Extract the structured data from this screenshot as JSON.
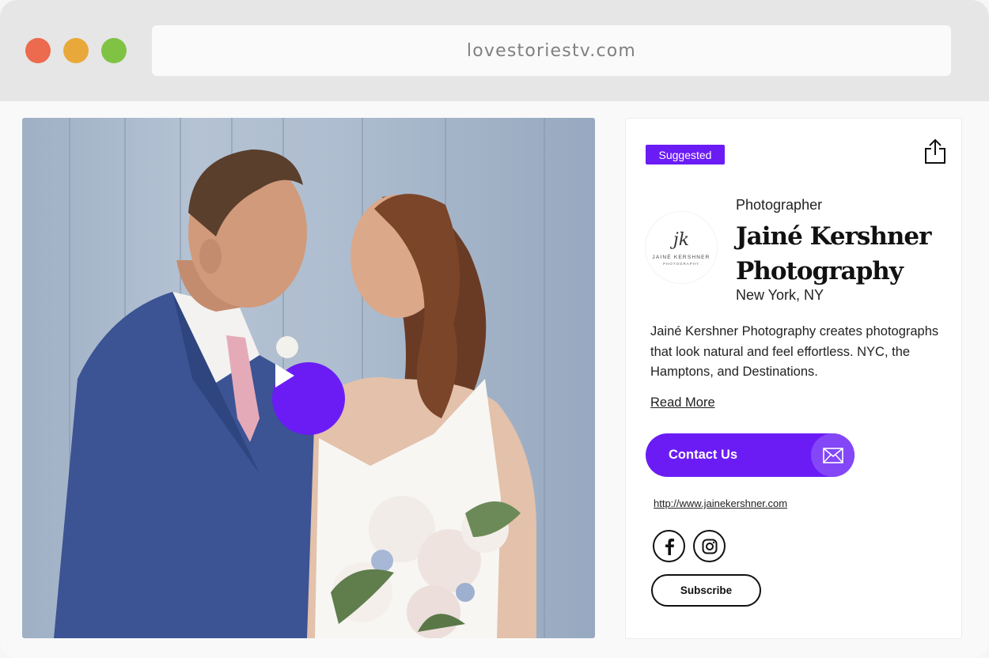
{
  "browser": {
    "url": "lovestoriestv.com"
  },
  "video": {
    "play_icon": "play-icon"
  },
  "vendor": {
    "badge": "Suggested",
    "share_icon": "share-icon",
    "logo": {
      "mark": "jk",
      "name": "JAINÉ KERSHNER",
      "subtitle": "PHOTOGRAPHY"
    },
    "role": "Photographer",
    "name": "Jainé Kershner Photography",
    "location": "New York, NY",
    "description": "Jainé Kershner Photography creates photographs that look natural and feel effortless. NYC, the Hamptons, and Destinations.",
    "read_more": "Read More",
    "contact_label": "Contact Us",
    "mail_icon": "mail-icon",
    "website": "http://www.jainekershner.com",
    "social": [
      "facebook-icon",
      "instagram-icon"
    ],
    "subscribe_label": "Subscribe"
  },
  "colors": {
    "accent": "#6b1cf5",
    "window_close": "#ec6a4e",
    "window_minimize": "#e9a93a",
    "window_zoom": "#80c344"
  }
}
